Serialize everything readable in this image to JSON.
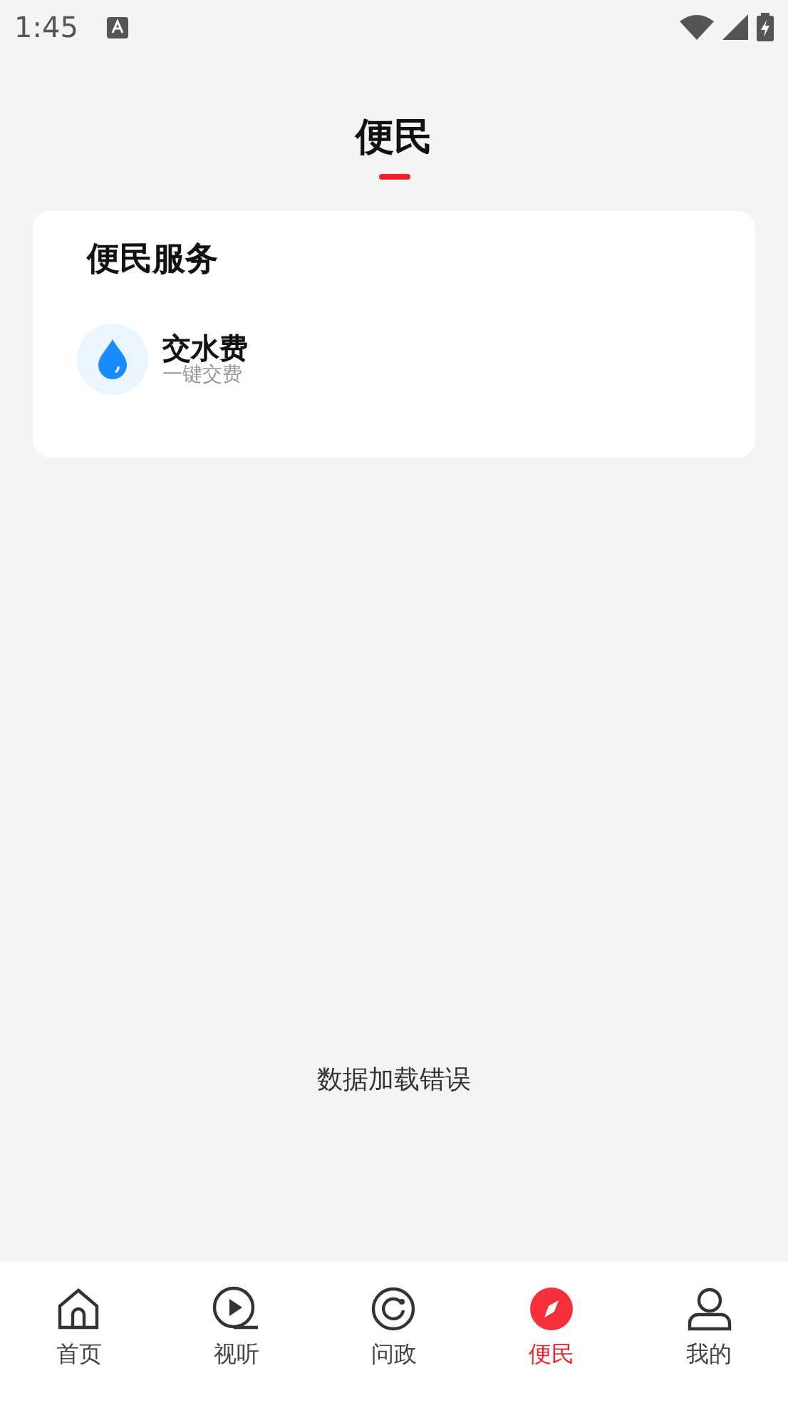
{
  "status_bar": {
    "time": "1:45"
  },
  "header": {
    "title": "便民",
    "selected": true
  },
  "card": {
    "title": "便民服务",
    "services": [
      {
        "name": "交水费",
        "subtitle": "一键交费",
        "kind": "water"
      }
    ]
  },
  "message": "数据加载错误",
  "nav": [
    {
      "label": "首页",
      "kind": "home",
      "selected": false
    },
    {
      "label": "视听",
      "kind": "play",
      "selected": false
    },
    {
      "label": "问政",
      "kind": "ask",
      "selected": false
    },
    {
      "label": "便民",
      "kind": "compass",
      "selected": true
    },
    {
      "label": "我的",
      "kind": "user",
      "selected": false
    }
  ]
}
